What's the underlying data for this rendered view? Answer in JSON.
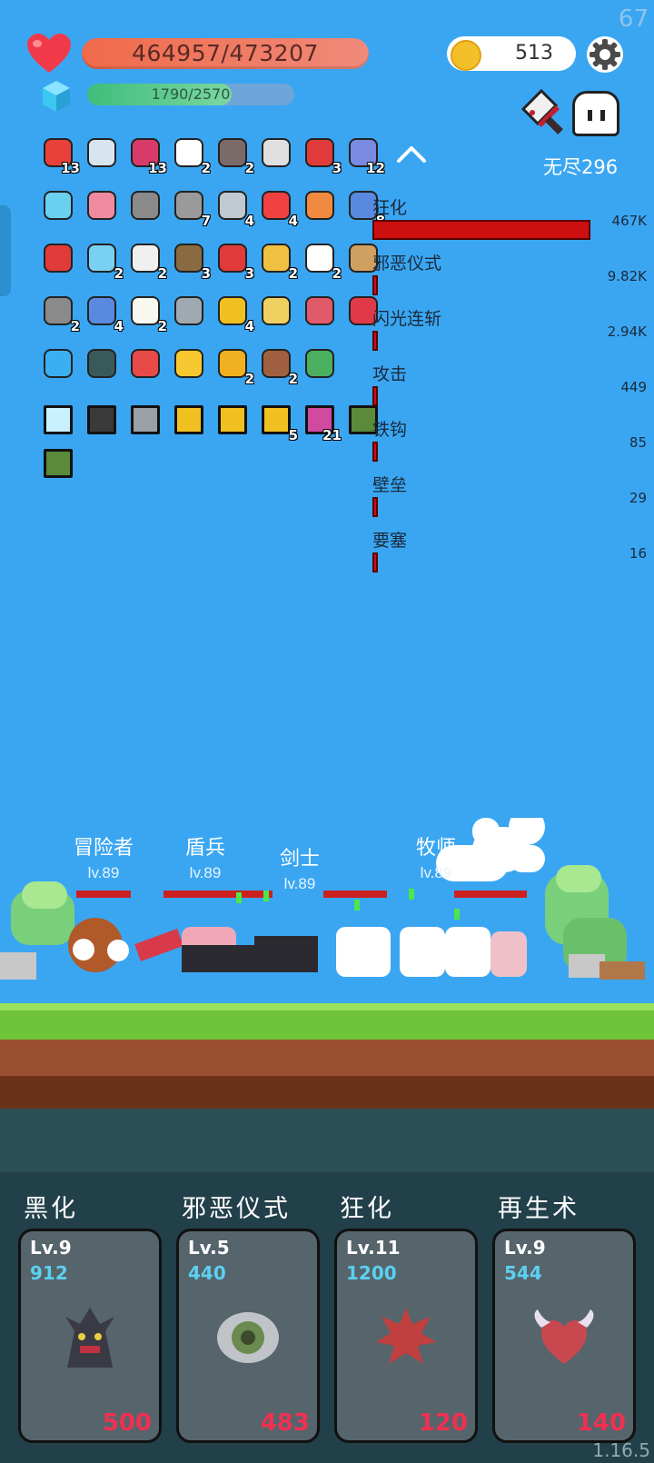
{
  "status": {
    "fps": "67",
    "hp_text": "464957/473207",
    "hp_fraction": 0.983,
    "xp_text": "1790/2570",
    "xp_fraction": 0.696,
    "coins": "513",
    "endless_label": "无尽296"
  },
  "items": [
    {
      "icon": "apple-icon",
      "count": "13",
      "color": "#e8403a"
    },
    {
      "icon": "sword-icon",
      "count": "",
      "color": "#d8e4f0"
    },
    {
      "icon": "jam-jar-icon",
      "count": "13",
      "color": "#d83a6a"
    },
    {
      "icon": "clipboard-icon",
      "count": "2",
      "color": "#ffffff"
    },
    {
      "icon": "tombstone-icon",
      "count": "2",
      "color": "#7a6a6a"
    },
    {
      "icon": "hook-icon",
      "count": "",
      "color": "#e0e0e0"
    },
    {
      "icon": "heart-icon",
      "count": "3",
      "color": "#e03a3a"
    },
    {
      "icon": "pill-icon",
      "count": "12",
      "color": "#7a8ae0"
    },
    {
      "icon": "scroll-icon",
      "count": "",
      "color": "#6ad0f0"
    },
    {
      "icon": "love-letter-icon",
      "count": "",
      "color": "#f08aa0"
    },
    {
      "icon": "helmet-icon",
      "count": "",
      "color": "#8a8a8a"
    },
    {
      "icon": "mace-icon",
      "count": "7",
      "color": "#9a9a9a"
    },
    {
      "icon": "axe-icon",
      "count": "4",
      "color": "#c0c8d0"
    },
    {
      "icon": "capsule-icon",
      "count": "4",
      "color": "#f04040"
    },
    {
      "icon": "crown-icon",
      "count": "",
      "color": "#f08a40"
    },
    {
      "icon": "shield-icon",
      "count": "8",
      "color": "#5a8ae0"
    },
    {
      "icon": "red-shield-icon",
      "count": "",
      "color": "#e03a3a"
    },
    {
      "icon": "potion-icon",
      "count": "2",
      "color": "#7ad0f0"
    },
    {
      "icon": "bulb-icon",
      "count": "2",
      "color": "#f0f0f0"
    },
    {
      "icon": "coconut-icon",
      "count": "3",
      "color": "#8a6a40"
    },
    {
      "icon": "broken-heart-icon",
      "count": "3",
      "color": "#e03a3a"
    },
    {
      "icon": "ring-icon",
      "count": "2",
      "color": "#f0c040"
    },
    {
      "icon": "chat-bubble-icon",
      "count": "2",
      "color": "#ffffff"
    },
    {
      "icon": "bow-icon",
      "count": "",
      "color": "#d0a060"
    },
    {
      "icon": "pot-icon",
      "count": "2",
      "color": "#8a8a8a"
    },
    {
      "icon": "star-card-icon",
      "count": "4",
      "color": "#5a8ae0"
    },
    {
      "icon": "fried-egg-icon",
      "count": "2",
      "color": "#f8f8f0"
    },
    {
      "icon": "dagger-icon",
      "count": "",
      "color": "#a0a8b0"
    },
    {
      "icon": "sunflower-icon",
      "count": "4",
      "color": "#f0c020"
    },
    {
      "icon": "note-icon",
      "count": "",
      "color": "#f0d060"
    },
    {
      "icon": "fish-hook-icon",
      "count": "",
      "color": "#e05a6a"
    },
    {
      "icon": "strawberry-icon",
      "count": "",
      "color": "#e03a4a"
    },
    {
      "icon": "blue-gem-icon",
      "count": "",
      "color": "#3ab0f0"
    },
    {
      "icon": "round-shield-icon",
      "count": "",
      "color": "#3a5a5a"
    },
    {
      "icon": "watermelon-icon",
      "count": "",
      "color": "#e84a4a"
    },
    {
      "icon": "gold-crown-icon",
      "count": "",
      "color": "#f8c830"
    },
    {
      "icon": "coin-stack-icon",
      "count": "2",
      "color": "#f0b020"
    },
    {
      "icon": "flag-cake-icon",
      "count": "2",
      "color": "#a06040"
    },
    {
      "icon": "cash-icon",
      "count": "",
      "color": "#4ab060"
    }
  ],
  "cards": [
    {
      "icon": "bright-card-icon",
      "count": "",
      "color": "#c8f0ff"
    },
    {
      "icon": "dark-blade-card-icon",
      "count": "",
      "color": "#3a3a3a"
    },
    {
      "icon": "armor-card-icon",
      "count": "",
      "color": "#9aa0a8"
    },
    {
      "icon": "angry-face-card-icon",
      "count": "",
      "color": "#f0c020"
    },
    {
      "icon": "angry-face-card-icon",
      "count": "",
      "color": "#f0c020"
    },
    {
      "icon": "angry-face-card-icon",
      "count": "5",
      "color": "#f0c020"
    },
    {
      "icon": "pink-rune-card-icon",
      "count": "21",
      "color": "#d04aa0"
    },
    {
      "icon": "sprout-card-icon",
      "count": "",
      "color": "#5a8a3a"
    },
    {
      "icon": "sprout-card-icon",
      "count": "",
      "color": "#5a8a3a"
    }
  ],
  "damage_stats": [
    {
      "name": "狂化",
      "value": "467K",
      "fraction": 1.0
    },
    {
      "name": "邪恶仪式",
      "value": "9.82K",
      "fraction": 0.021
    },
    {
      "name": "闪光连斩",
      "value": "2.94K",
      "fraction": 0.006
    },
    {
      "name": "攻击",
      "value": "449",
      "fraction": 0.001
    },
    {
      "name": "铁钩",
      "value": "85",
      "fraction": 0.0002
    },
    {
      "name": "壁垒",
      "value": "29",
      "fraction": 0.0001
    },
    {
      "name": "要塞",
      "value": "16",
      "fraction": 3e-05
    }
  ],
  "enemies": [
    {
      "name": "冒险者",
      "level": "lv.89"
    },
    {
      "name": "盾兵",
      "level": "lv.89"
    },
    {
      "name": "剑士",
      "level": "lv.89"
    },
    {
      "name": "牧师",
      "level": "lv.89"
    }
  ],
  "skills": [
    {
      "name": "黑化",
      "level": "Lv.9",
      "cost": "912",
      "price": "500",
      "icon": "dark-tree-icon"
    },
    {
      "name": "邪恶仪式",
      "level": "Lv.5",
      "cost": "440",
      "price": "483",
      "icon": "eye-icon"
    },
    {
      "name": "狂化",
      "level": "Lv.11",
      "cost": "1200",
      "price": "120",
      "icon": "rage-splat-icon"
    },
    {
      "name": "再生术",
      "level": "Lv.9",
      "cost": "544",
      "price": "140",
      "icon": "winged-heart-icon"
    }
  ],
  "version": "1.16.5"
}
